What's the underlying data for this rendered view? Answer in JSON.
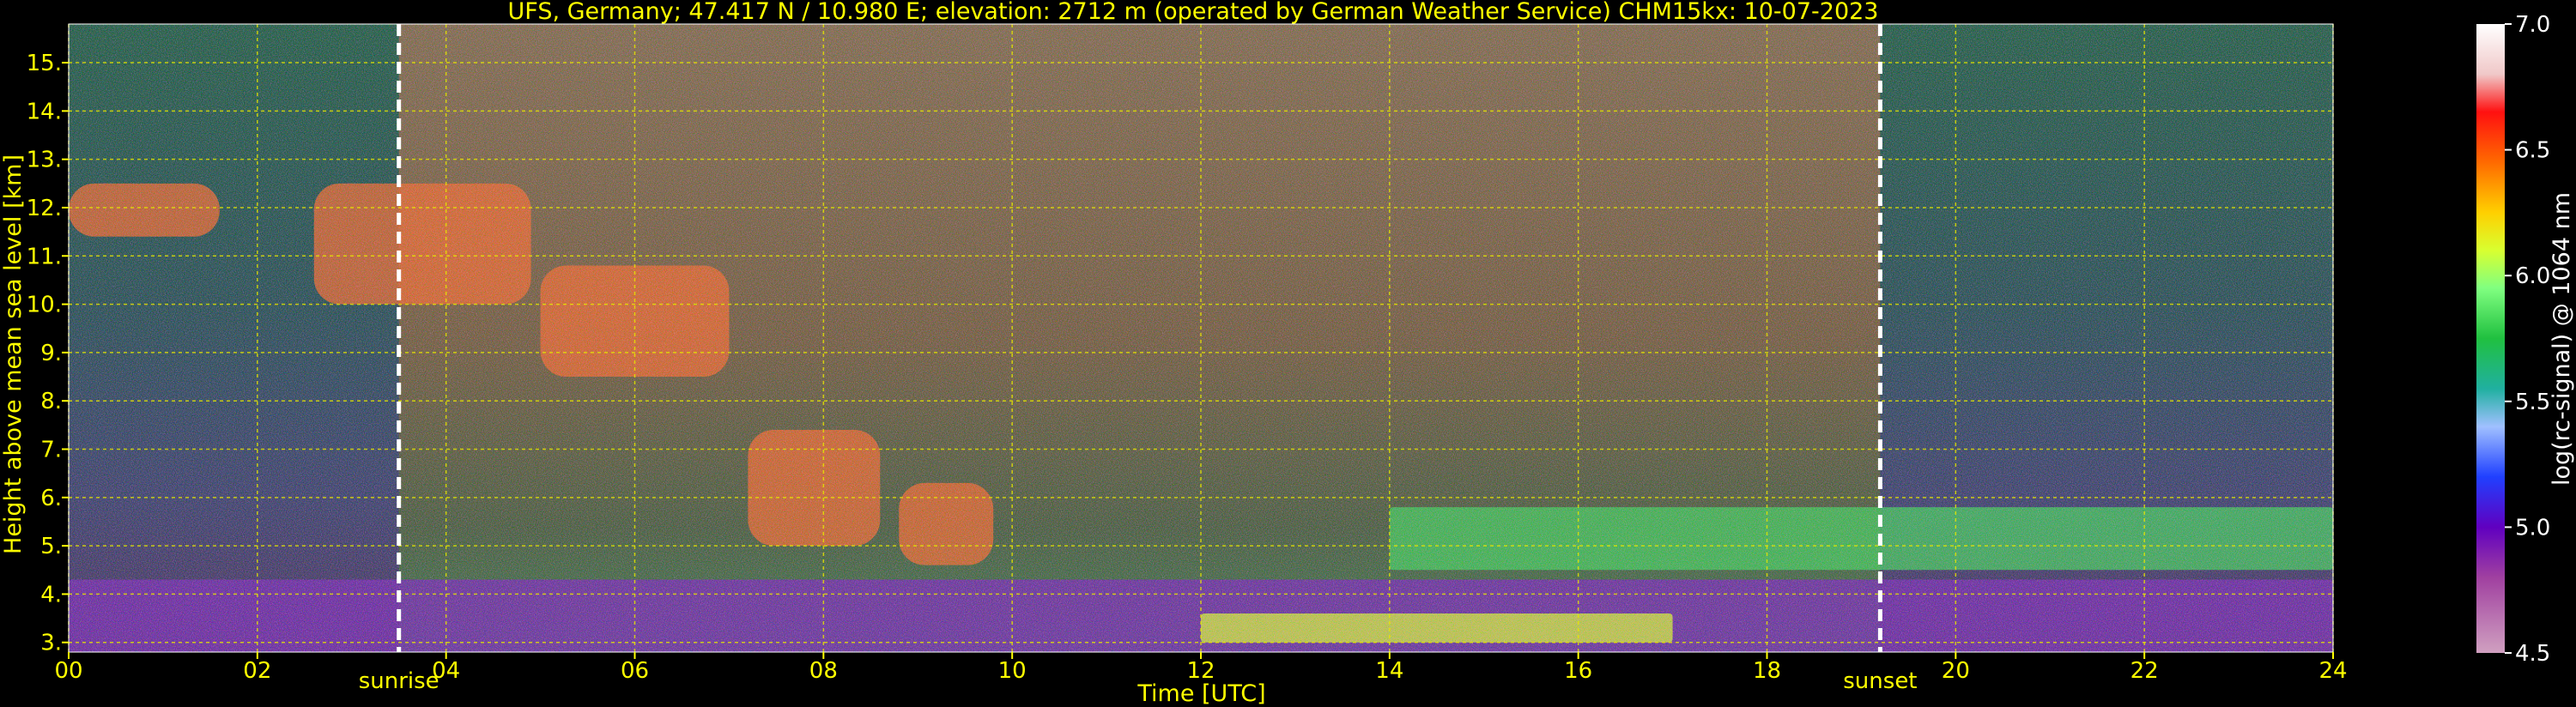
{
  "chart_data": {
    "type": "heatmap",
    "title": "UFS, Germany; 47.417 N / 10.980 E; elevation: 2712 m  (operated by German Weather Service)    CHM15kx: 10-07-2023",
    "xlabel": "Time [UTC]",
    "ylabel": "Height above mean sea level [km]",
    "xlim": [
      0,
      24
    ],
    "ylim": [
      2.8,
      15.8
    ],
    "x_ticks": [
      "00",
      "02",
      "04",
      "06",
      "08",
      "10",
      "12",
      "14",
      "16",
      "18",
      "20",
      "22",
      "24"
    ],
    "y_ticks": [
      "3.",
      "4.",
      "5.",
      "6.",
      "7.",
      "8.",
      "9.",
      "10.",
      "11.",
      "12.",
      "13.",
      "14.",
      "15."
    ],
    "grid": true,
    "annotations": [
      {
        "text": "sunrise",
        "x": 3.5
      },
      {
        "text": "sunset",
        "x": 19.2
      }
    ],
    "colorbar": {
      "label": "log(rc-signal) @ 1064 nm",
      "range": [
        4.5,
        7.0
      ],
      "ticks": [
        "7.0",
        "6.5",
        "6.0",
        "5.5",
        "5.0",
        "4.5"
      ]
    },
    "features": [
      {
        "kind": "cirrus",
        "t_start": 0.0,
        "t_end": 1.6,
        "h_low": 11.4,
        "h_high": 12.5
      },
      {
        "kind": "cirrus",
        "t_start": 2.6,
        "t_end": 4.9,
        "h_low": 10.0,
        "h_high": 12.5
      },
      {
        "kind": "cirrus",
        "t_start": 5.0,
        "t_end": 7.0,
        "h_low": 8.5,
        "h_high": 10.8
      },
      {
        "kind": "cirrus",
        "t_start": 7.2,
        "t_end": 8.6,
        "h_low": 5.0,
        "h_high": 7.4
      },
      {
        "kind": "cirrus",
        "t_start": 8.8,
        "t_end": 9.8,
        "h_low": 4.6,
        "h_high": 6.3
      },
      {
        "kind": "boundary_layer",
        "t_start": 0.0,
        "t_end": 24.0,
        "h_low": 2.8,
        "h_high": 4.3
      },
      {
        "kind": "aerosol_layer",
        "t_start": 14.0,
        "t_end": 24.0,
        "h_low": 4.5,
        "h_high": 5.8
      },
      {
        "kind": "low_cloud",
        "t_start": 12.0,
        "t_end": 17.0,
        "h_low": 3.0,
        "h_high": 3.6
      }
    ]
  }
}
